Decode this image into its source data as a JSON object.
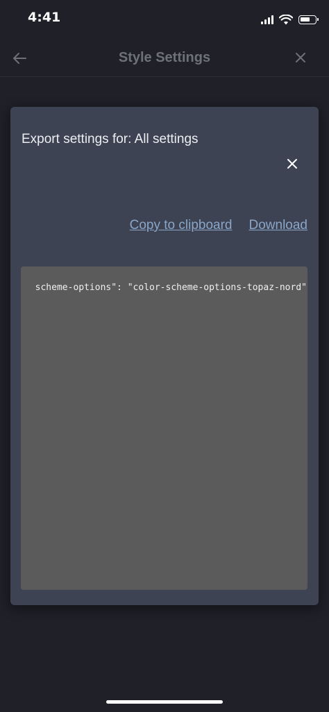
{
  "status_bar": {
    "time": "4:41",
    "icons": [
      "signal-icon",
      "wifi-icon",
      "battery-icon"
    ]
  },
  "header": {
    "title": "Style Settings",
    "back_icon": "arrow-left-icon",
    "close_icon": "close-icon"
  },
  "modal": {
    "title": "Export settings for: All settings",
    "close_icon": "close-icon",
    "links": {
      "copy": "Copy to clipboard",
      "download": "Download"
    },
    "code_text": "scheme-options\": \"color-scheme-options-topaz-nord\""
  },
  "colors": {
    "background": "#1f2028",
    "modal_background": "#3d4352",
    "code_background": "#5b5b5b",
    "link": "#8aa6c8",
    "header_title": "#6f717a"
  }
}
